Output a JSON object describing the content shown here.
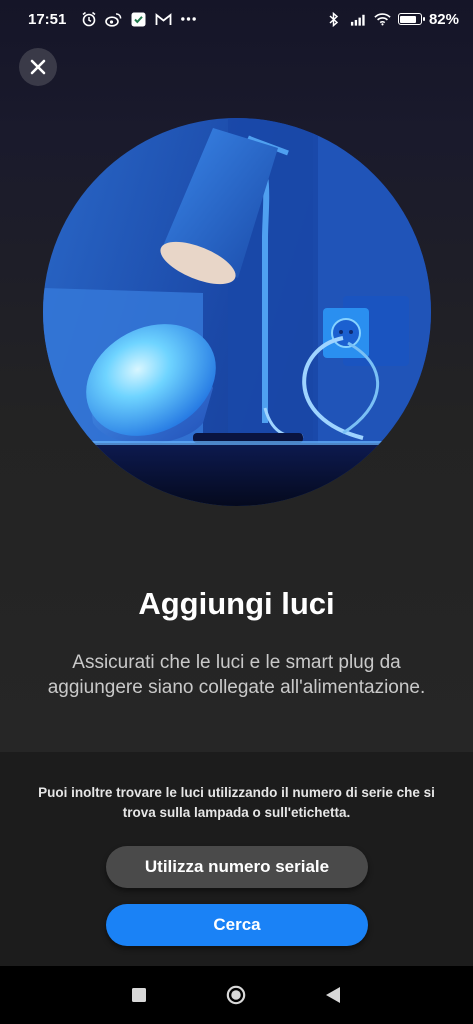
{
  "status_bar": {
    "time": "17:51",
    "battery": "82%",
    "battery_level": 0.82,
    "left_icons": [
      "alarm-icon",
      "weibo-icon",
      "app-icon",
      "gmail-icon",
      "more-dots-icon"
    ],
    "right_icons": [
      "bluetooth-icon",
      "signal-icon",
      "wifi-icon",
      "battery-icon"
    ]
  },
  "screen": {
    "title": "Aggiungi luci",
    "description": "Assicurati che le luci e le smart plug da aggiungere siano collegate all'alimentazione.",
    "hint": "Puoi inoltre trovare le luci utilizzando il numero di serie che si trova sulla lampada o sull'etichetta.",
    "serial_button": "Utilizza numero seriale",
    "search_button": "Cerca"
  },
  "colors": {
    "accent": "#1a82f6",
    "secondary_button": "#4a4a4a",
    "background": "#1e1e1e"
  },
  "nav": {
    "icons": [
      "recent-apps-icon",
      "home-icon",
      "back-icon"
    ]
  }
}
